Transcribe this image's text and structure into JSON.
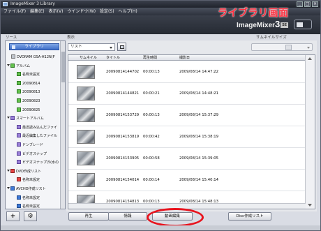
{
  "window": {
    "title": "ImageMixer 3 Library"
  },
  "menu": [
    "ファイル(F)",
    "編集(E)",
    "表示(V)",
    "ウインドウ(W)",
    "設定(S)",
    "ヘルプ(H)"
  ],
  "annotation": {
    "label": "ライブラリ画面",
    "color": "#ff2d3d"
  },
  "logo": {
    "name": "ImageMixer",
    "version": "3",
    "edition": "SE"
  },
  "source": {
    "header": "ソース",
    "library_button": "ライブラリ",
    "tree": [
      {
        "label": "DVDRAM GSA-H12N(F",
        "icon": "drive-icon",
        "level": 0,
        "expander": false
      },
      {
        "label": "アルバム",
        "icon": "album-icon",
        "level": 0,
        "expander": true
      },
      {
        "label": "名称未設定",
        "icon": "album-icon",
        "level": 1
      },
      {
        "label": "20090814",
        "icon": "album-icon",
        "level": 1
      },
      {
        "label": "20090813",
        "icon": "album-icon",
        "level": 1
      },
      {
        "label": "20090823",
        "icon": "album-icon",
        "level": 1
      },
      {
        "label": "20090825",
        "icon": "album-icon",
        "level": 1
      },
      {
        "label": "スマートアルバム",
        "icon": "smart-album-icon",
        "level": 0,
        "expander": true
      },
      {
        "label": "最近読み込んだファイ",
        "icon": "smart-album-icon",
        "level": 1
      },
      {
        "label": "最近編集したファイル",
        "icon": "smart-album-icon",
        "level": 1
      },
      {
        "label": "ドンブレード",
        "icon": "smart-album-icon",
        "level": 1
      },
      {
        "label": "ビデオスナップ",
        "icon": "smart-album-icon",
        "level": 1
      },
      {
        "label": "ビデオスナップ(5(水の",
        "icon": "smart-album-icon",
        "level": 1
      },
      {
        "label": "DVD作成リスト",
        "icon": "dvd-list-icon",
        "level": 0,
        "expander": true
      },
      {
        "label": "名称未設定",
        "icon": "dvd-list-icon",
        "level": 1
      },
      {
        "label": "AVCHD作成リスト",
        "icon": "avchd-list-icon",
        "level": 0,
        "expander": true
      },
      {
        "label": "名称未設定",
        "icon": "avchd-list-icon",
        "level": 1
      },
      {
        "label": "名称未設定",
        "icon": "avchd-list-icon",
        "level": 1
      }
    ],
    "add_button": "+",
    "tools_button": "⚙"
  },
  "view": {
    "header": "表示",
    "mode": "リスト",
    "thumb_size_label": "サムネイルサイズ",
    "columns": [
      "サムネイル",
      "タイトル",
      "再生時間",
      "撮影日"
    ],
    "rows": [
      {
        "title": "20090814144702",
        "duration": "00:00:13",
        "date": "2009/08/14 14:47:22"
      },
      {
        "title": "20090814144821",
        "duration": "00:00:21",
        "date": "2009/08/14 14:48:21"
      },
      {
        "title": "20090814153729",
        "duration": "00:00:13",
        "date": "2009/08/14 15:37:29"
      },
      {
        "title": "20090814153819",
        "duration": "00:00:42",
        "date": "2009/08/14 15:38:19"
      },
      {
        "title": "20090814153905",
        "duration": "00:00:58",
        "date": "2009/08/14 15:39:05"
      },
      {
        "title": "20090814154014",
        "duration": "00:00:14",
        "date": "2009/08/14 15:40:14"
      },
      {
        "title": "20090814154813",
        "duration": "00:00:13",
        "date": "2009/08/14 15:48:13"
      }
    ]
  },
  "actions": {
    "play": "再生",
    "info": "情報",
    "video_edit": "動画編集",
    "disc_list": "Disc作成リスト"
  }
}
